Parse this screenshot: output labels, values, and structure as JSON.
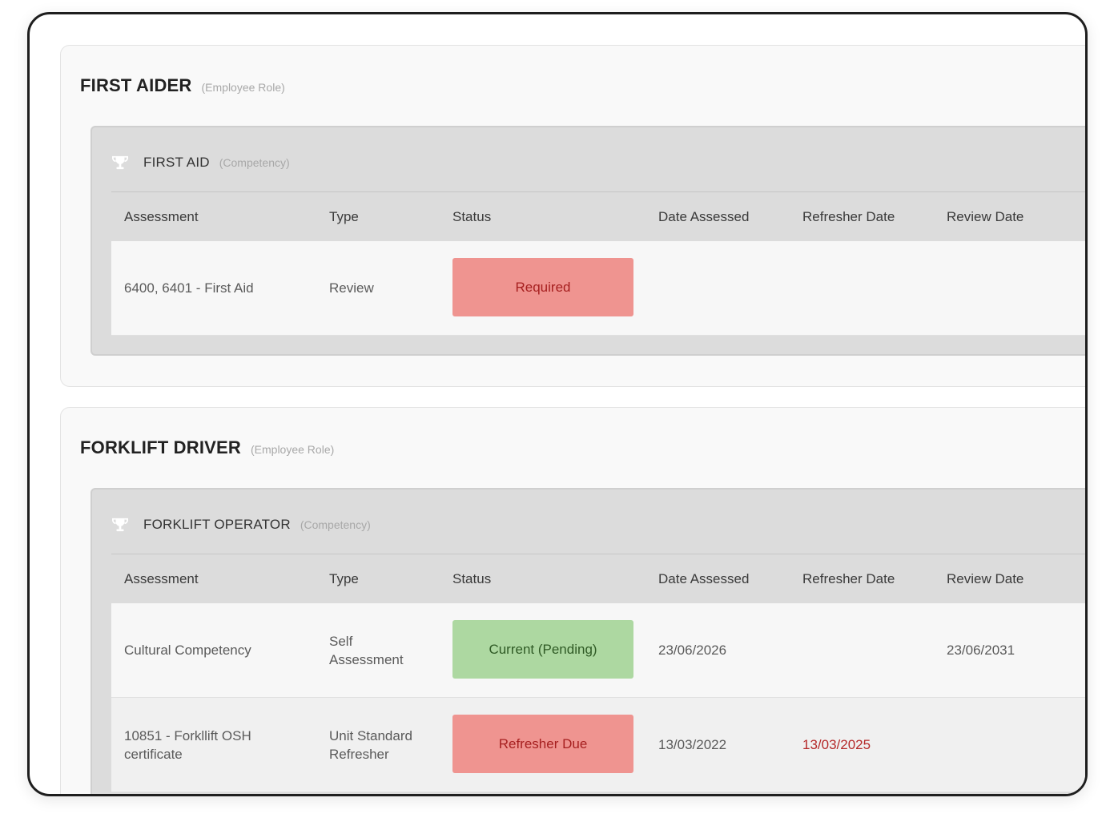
{
  "colors": {
    "required_bg": "#ef9490",
    "required_text": "#a61f1f",
    "current_bg": "#add8a1",
    "current_text": "#2f5a25",
    "overdue_text": "#b52a2a"
  },
  "roles": [
    {
      "title": "FIRST AIDER",
      "kind": "(Employee Role)",
      "competency": {
        "icon": "trophy-icon",
        "name": "FIRST AID",
        "kind": "(Competency)",
        "headers": {
          "assessment": "Assessment",
          "type": "Type",
          "status": "Status",
          "date_assessed": "Date Assessed",
          "refresher_date": "Refresher Date",
          "review_date": "Review Date"
        },
        "rows": [
          {
            "assessment": "6400, 6401 - First Aid",
            "type": "Review",
            "status": "Required",
            "date_assessed": "",
            "refresher_date": "",
            "review_date": ""
          }
        ]
      }
    },
    {
      "title": "FORKLIFT DRIVER",
      "kind": "(Employee Role)",
      "competency": {
        "icon": "trophy-icon",
        "name": "FORKLIFT OPERATOR",
        "kind": "(Competency)",
        "headers": {
          "assessment": "Assessment",
          "type": "Type",
          "status": "Status",
          "date_assessed": "Date Assessed",
          "refresher_date": "Refresher Date",
          "review_date": "Review Date"
        },
        "rows": [
          {
            "assessment": "Cultural Competency",
            "type": "Self Assessment",
            "status": "Current (Pending)",
            "date_assessed": "23/06/2026",
            "refresher_date": "",
            "review_date": "23/06/2031"
          },
          {
            "assessment": "10851 - Forkllift OSH certificate",
            "type": "Unit Standard Refresher",
            "status": "Refresher Due",
            "date_assessed": "13/03/2022",
            "refresher_date": "13/03/2025",
            "review_date": ""
          }
        ]
      }
    }
  ]
}
